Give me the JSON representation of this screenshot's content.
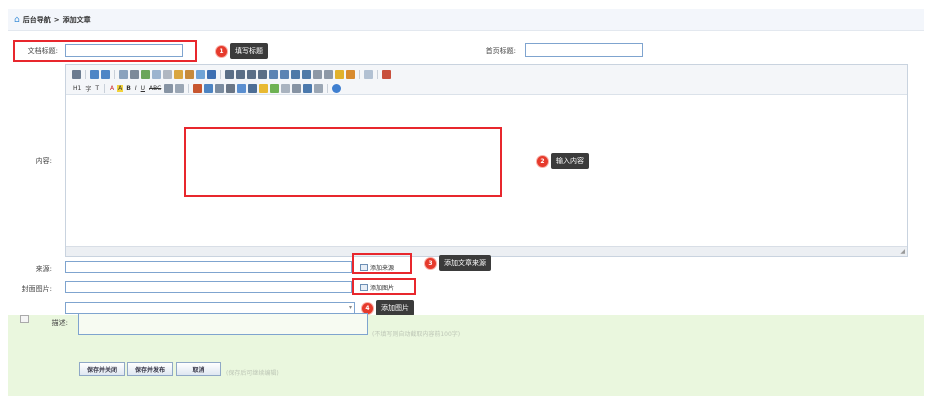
{
  "breadcrumb": {
    "home": "后台导航",
    "separator": ">",
    "current": "添加文章"
  },
  "fields": {
    "title_label": "文档标题:",
    "title_value": "",
    "home_title_label": "首页标题:",
    "home_title_value": "",
    "content_label": "内容:",
    "source_label": "来源:",
    "source_value": "",
    "cover_label": "封面图片:",
    "cover_value": "",
    "desc_label": "描述:"
  },
  "toolbar": {
    "heading": "H1",
    "font_family": "字",
    "font_size": "T",
    "font_color": "A",
    "bg_color": "A",
    "bold": "B",
    "italic": "I",
    "underline": "U",
    "strike": "ABC"
  },
  "buttons": {
    "add_source": "添加来源",
    "add_image": "添加图片",
    "save_close": "保存并关闭",
    "save_publish": "保存并发布",
    "cancel": "取消"
  },
  "callouts": [
    {
      "num": "1",
      "text": "填写标题"
    },
    {
      "num": "2",
      "text": "输入内容"
    },
    {
      "num": "3",
      "text": "添加文章来源"
    },
    {
      "num": "4",
      "text": "添加图片"
    }
  ],
  "hints": {
    "desc_hint": "(不填写则自动截取内容前100字)",
    "save_hint": "(保存后可继续编辑)"
  },
  "colors": {
    "callout_red": "#e63a2c",
    "box_red": "#e8272d",
    "input_border": "#7fa4cf",
    "green_band": "#eaf7de"
  }
}
